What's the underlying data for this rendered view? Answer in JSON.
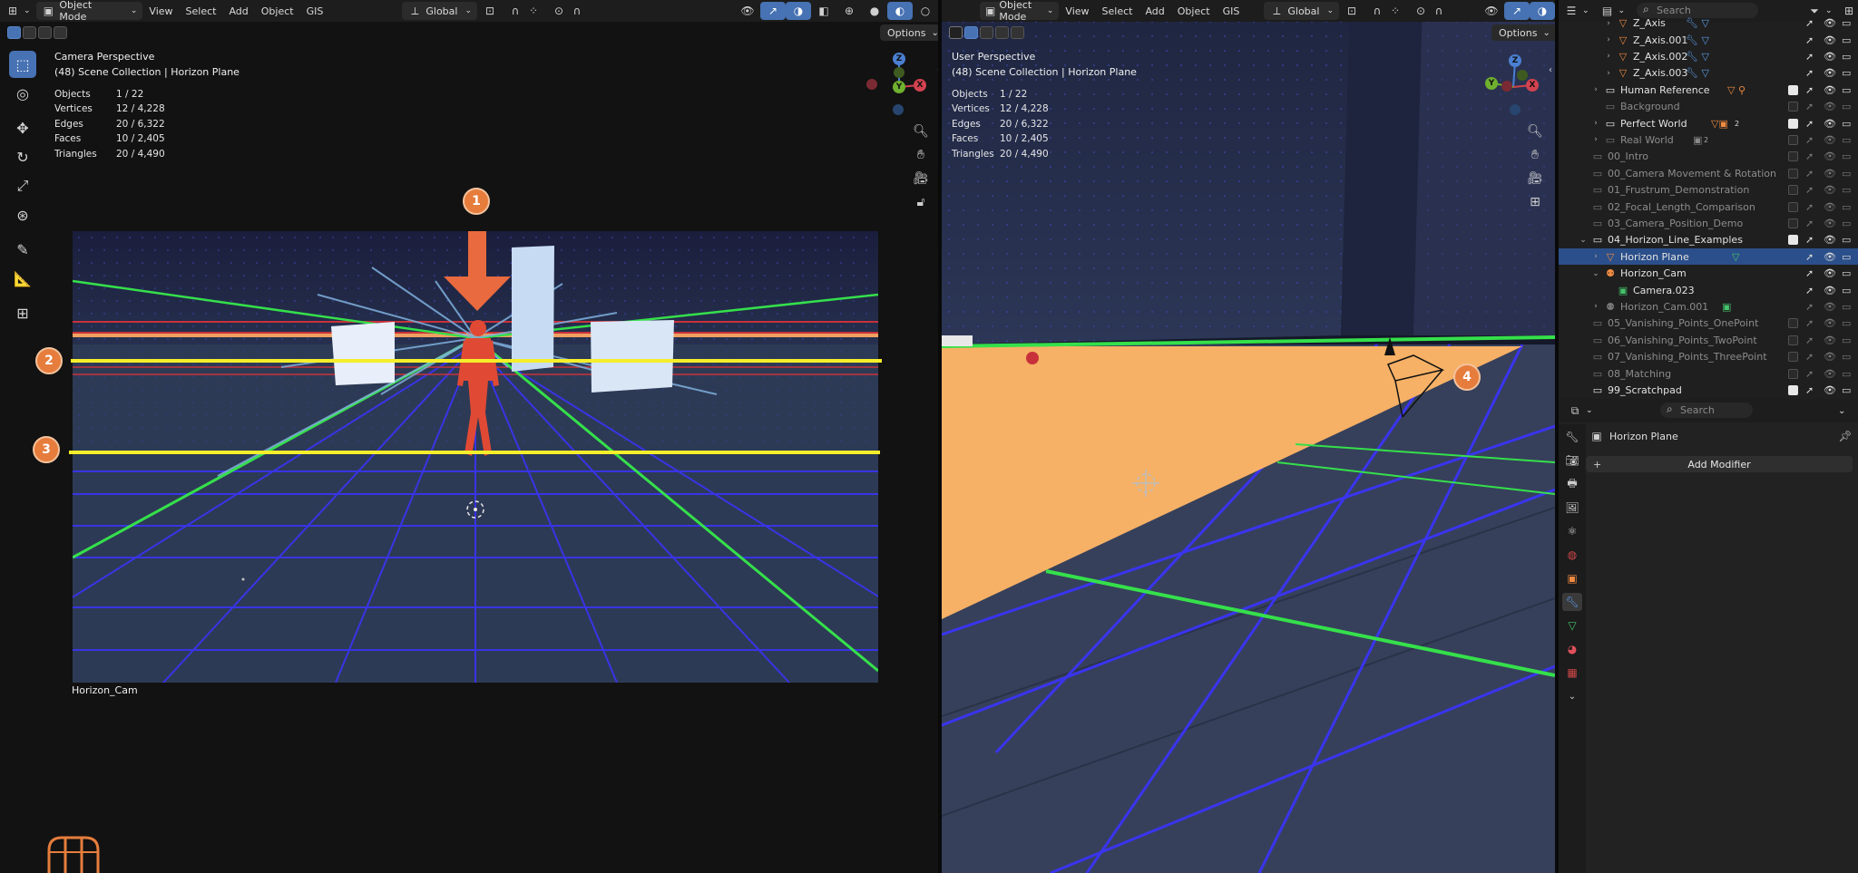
{
  "left_viewport": {
    "header": {
      "mode": "Object Mode",
      "menus": [
        "View",
        "Select",
        "Add",
        "Object",
        "GIS"
      ],
      "orientation": "Global",
      "options": "Options"
    },
    "view_name": "Camera Perspective",
    "collection_path": "(48) Scene Collection | Horizon Plane",
    "stats": [
      {
        "k": "Objects",
        "v": "1 / 22"
      },
      {
        "k": "Vertices",
        "v": "12 / 4,228"
      },
      {
        "k": "Edges",
        "v": "20 / 6,322"
      },
      {
        "k": "Faces",
        "v": "10 / 2,405"
      },
      {
        "k": "Triangles",
        "v": "20 / 4,490"
      }
    ],
    "camera_name": "Horizon_Cam",
    "badges": [
      "1",
      "2",
      "3"
    ]
  },
  "right_viewport": {
    "header": {
      "mode": "Object Mode",
      "menus": [
        "View",
        "Select",
        "Add",
        "Object",
        "GIS"
      ],
      "orientation": "Global",
      "options": "Options"
    },
    "view_name": "User Perspective",
    "collection_path": "(48) Scene Collection | Horizon Plane",
    "stats": [
      {
        "k": "Objects",
        "v": "1 / 22"
      },
      {
        "k": "Vertices",
        "v": "12 / 4,228"
      },
      {
        "k": "Edges",
        "v": "20 / 6,322"
      },
      {
        "k": "Faces",
        "v": "10 / 2,405"
      },
      {
        "k": "Triangles",
        "v": "20 / 4,490"
      }
    ],
    "badge": "4"
  },
  "gizmo": {
    "z": "Z",
    "y": "Y",
    "x": "X"
  },
  "outliner": {
    "search_placeholder": "Search",
    "rows": [
      {
        "label": "Z_Axis",
        "indent": 3,
        "icon": "mesh",
        "expand": ">",
        "checked": null,
        "dim": false,
        "selected": false
      },
      {
        "label": "Z_Axis.001",
        "indent": 3,
        "icon": "mesh",
        "expand": ">",
        "checked": null,
        "dim": false,
        "selected": false
      },
      {
        "label": "Z_Axis.002",
        "indent": 3,
        "icon": "mesh",
        "expand": ">",
        "checked": null,
        "dim": false,
        "selected": false
      },
      {
        "label": "Z_Axis.003",
        "indent": 3,
        "icon": "mesh",
        "expand": ">",
        "checked": null,
        "dim": false,
        "selected": false
      },
      {
        "label": "Human Reference",
        "indent": 2,
        "icon": "collection",
        "expand": ">",
        "checked": true,
        "dim": false,
        "selected": false
      },
      {
        "label": "Background",
        "indent": 2,
        "icon": "collection",
        "expand": "",
        "checked": false,
        "dim": true,
        "selected": false
      },
      {
        "label": "Perfect World",
        "indent": 2,
        "icon": "collection",
        "expand": ">",
        "checked": true,
        "dim": false,
        "selected": false
      },
      {
        "label": "Real World",
        "indent": 2,
        "icon": "collection",
        "expand": ">",
        "checked": false,
        "dim": true,
        "selected": false
      },
      {
        "label": "00_Intro",
        "indent": 1,
        "icon": "collection",
        "expand": "",
        "checked": false,
        "dim": true,
        "selected": false
      },
      {
        "label": "00_Camera Movement & Rotation",
        "indent": 1,
        "icon": "collection",
        "expand": "",
        "checked": false,
        "dim": true,
        "selected": false
      },
      {
        "label": "01_Frustrum_Demonstration",
        "indent": 1,
        "icon": "collection",
        "expand": "",
        "checked": false,
        "dim": true,
        "selected": false
      },
      {
        "label": "02_Focal_Length_Comparison",
        "indent": 1,
        "icon": "collection",
        "expand": "",
        "checked": false,
        "dim": true,
        "selected": false
      },
      {
        "label": "03_Camera_Position_Demo",
        "indent": 1,
        "icon": "collection",
        "expand": "",
        "checked": false,
        "dim": true,
        "selected": false
      },
      {
        "label": "04_Horizon_Line_Examples",
        "indent": 1,
        "icon": "collection",
        "expand": "v",
        "checked": true,
        "dim": false,
        "selected": false
      },
      {
        "label": "Horizon Plane",
        "indent": 2,
        "icon": "mesh-obj",
        "expand": ">",
        "checked": null,
        "dim": false,
        "selected": true
      },
      {
        "label": "Horizon_Cam",
        "indent": 2,
        "icon": "camera",
        "expand": "v",
        "checked": null,
        "dim": false,
        "selected": false
      },
      {
        "label": "Camera.023",
        "indent": 3,
        "icon": "camera-data",
        "expand": "",
        "checked": null,
        "dim": false,
        "selected": false
      },
      {
        "label": "Horizon_Cam.001",
        "indent": 2,
        "icon": "camera",
        "expand": ">",
        "checked": null,
        "dim": true,
        "selected": false
      },
      {
        "label": "05_Vanishing_Points_OnePoint",
        "indent": 1,
        "icon": "collection",
        "expand": "",
        "checked": false,
        "dim": true,
        "selected": false
      },
      {
        "label": "06_Vanishing_Points_TwoPoint",
        "indent": 1,
        "icon": "collection",
        "expand": "",
        "checked": false,
        "dim": true,
        "selected": false
      },
      {
        "label": "07_Vanishing_Points_ThreePoint",
        "indent": 1,
        "icon": "collection",
        "expand": "",
        "checked": false,
        "dim": true,
        "selected": false
      },
      {
        "label": "08_Matching",
        "indent": 1,
        "icon": "collection",
        "expand": "",
        "checked": false,
        "dim": true,
        "selected": false
      },
      {
        "label": "99_Scratchpad",
        "indent": 1,
        "icon": "collection",
        "expand": "",
        "checked": true,
        "dim": false,
        "selected": false
      }
    ],
    "extras": {
      "perfect_world_count": "2",
      "real_world_count": "2"
    }
  },
  "properties": {
    "search_placeholder": "Search",
    "object_name": "Horizon Plane",
    "add_modifier": "Add Modifier",
    "tabs": [
      "tool-icon",
      "render-icon",
      "output-icon",
      "view-layer-icon",
      "scene-icon",
      "world-icon",
      "object-icon",
      "modifier-icon",
      "data-icon",
      "material-icon",
      "texture-icon",
      "more-icon"
    ],
    "active_tab": "modifier-icon"
  },
  "colors": {
    "accent": "#4772b3",
    "badge": "#e67d3c",
    "yellow_line": "#f5ee2a",
    "orange_plane": "#f6b166",
    "grid_green": "#35e04b",
    "grid_blue": "#3b33ff"
  }
}
